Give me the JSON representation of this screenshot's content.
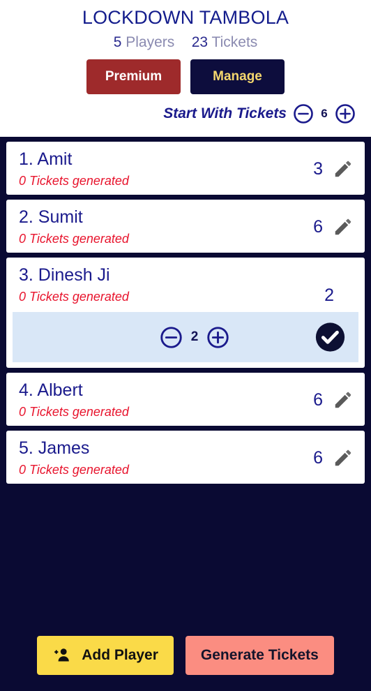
{
  "header": {
    "title": "LOCKDOWN TAMBOLA",
    "stats": [
      {
        "num": "5",
        "label": "Players"
      },
      {
        "num": "23",
        "label": "Tickets"
      }
    ],
    "premium_label": "Premium",
    "manage_label": "Manage",
    "start_with_tickets_label": "Start With Tickets",
    "start_with_tickets_value": "6",
    "minus_icon": "circle-minus-icon",
    "plus_icon": "circle-plus-icon"
  },
  "players": [
    {
      "name": "1. Amit",
      "status": "0 Tickets generated",
      "tickets": "3",
      "expanded": false,
      "edit_icon": "pencil-icon"
    },
    {
      "name": "2. Sumit",
      "status": "0 Tickets generated",
      "tickets": "6",
      "expanded": false,
      "edit_icon": "pencil-icon"
    },
    {
      "name": "3. Dinesh Ji",
      "status": "0 Tickets generated",
      "tickets": "2",
      "expanded": true,
      "edit_value": "2",
      "confirm_icon": "check-circle-icon",
      "minus_icon": "circle-minus-icon",
      "plus_icon": "circle-plus-icon"
    },
    {
      "name": "4. Albert",
      "status": "0 Tickets generated",
      "tickets": "6",
      "expanded": false,
      "edit_icon": "pencil-icon"
    },
    {
      "name": "5. James",
      "status": "0 Tickets generated",
      "tickets": "6",
      "expanded": false,
      "edit_icon": "pencil-icon"
    }
  ],
  "footer": {
    "add_player_label": "Add Player",
    "add_player_icon": "person-add-icon",
    "generate_tickets_label": "Generate Tickets"
  },
  "colors": {
    "background": "#0a0a33",
    "header_bg": "#ffffff",
    "title": "#131c8c",
    "premium_bg": "#9e2a2b",
    "manage_bg": "#0d0d3d",
    "manage_text": "#f5d76e",
    "status_red": "#e8142d",
    "edit_row_bg": "#d9e7f7",
    "add_player_bg": "#fada48",
    "generate_bg": "#fb8d81"
  }
}
